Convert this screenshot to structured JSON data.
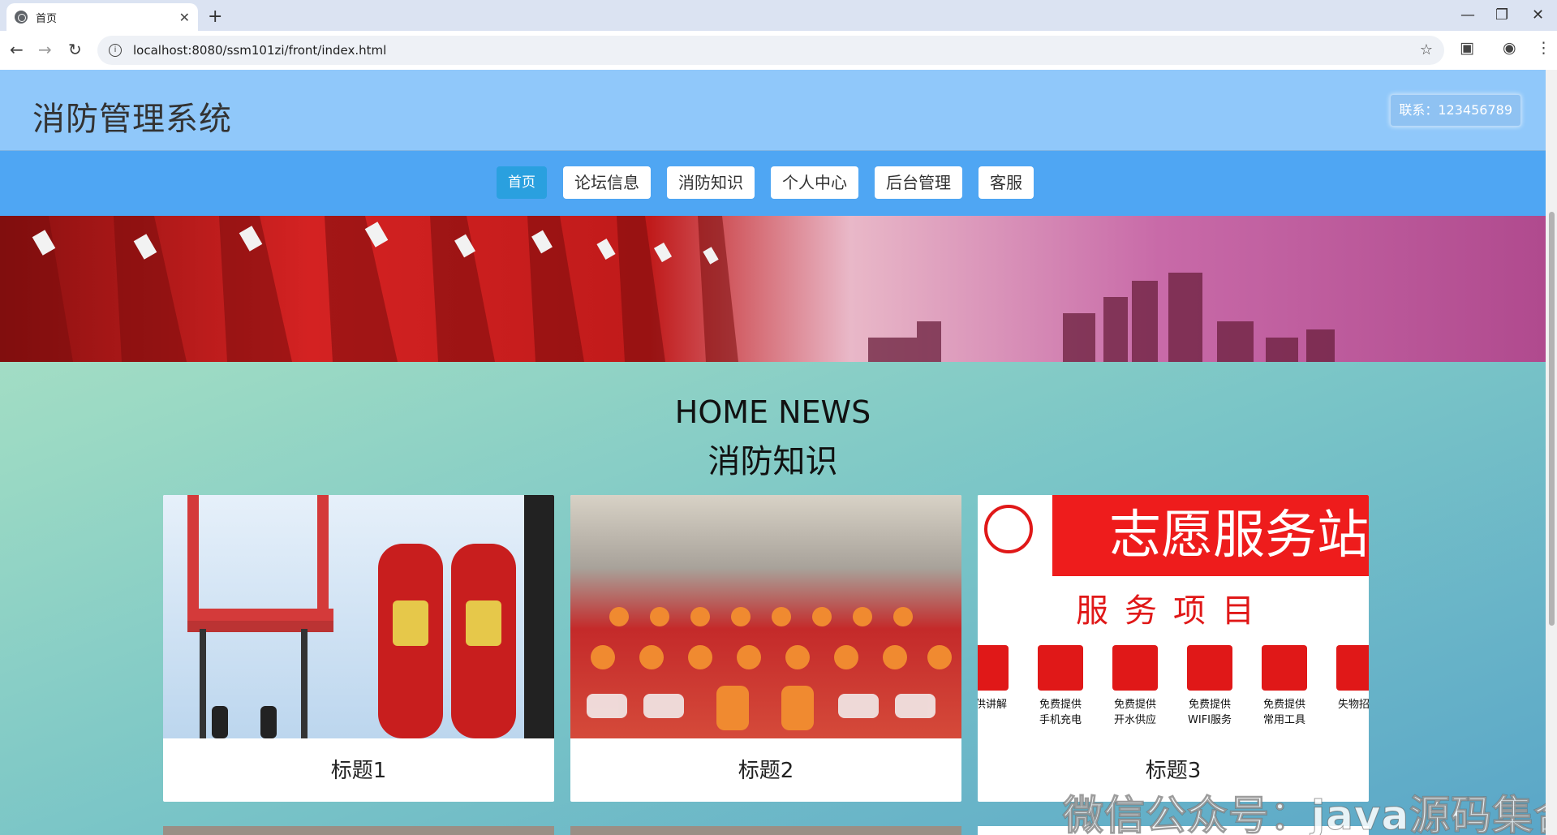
{
  "browser": {
    "tab_title": "首页",
    "new_tab": "+",
    "url": "localhost:8080/ssm101zi/front/index.html",
    "window_controls": [
      "—",
      "❐",
      "✕"
    ]
  },
  "site": {
    "title": "消防管理系统",
    "contact": "联系：123456789"
  },
  "nav": {
    "items": [
      "首页",
      "论坛信息",
      "消防知识",
      "个人中心",
      "后台管理",
      "客服"
    ],
    "active_index": 0
  },
  "section": {
    "title_en": "HOME NEWS",
    "title_zh": "消防知识"
  },
  "cards": [
    {
      "title": "标题1",
      "image": "fire-extinguisher-cylinders"
    },
    {
      "title": "标题2",
      "image": "auditorium-group-photo"
    },
    {
      "title": "标题3",
      "image": "volunteer-service-station-sign",
      "image_text": {
        "header": "志愿服务站",
        "subheader": "服务项目",
        "items": [
          "提供讲解",
          "免费提供手机充电",
          "免费提供开水供应",
          "免费提供WIFI服务",
          "免费提供常用工具",
          "失物招领"
        ]
      }
    }
  ],
  "watermark": "微信公众号：java源码集合",
  "colors": {
    "header_bg": "#90c8fa",
    "nav_bg": "#4fa6f3",
    "nav_active": "#2aa0df"
  }
}
